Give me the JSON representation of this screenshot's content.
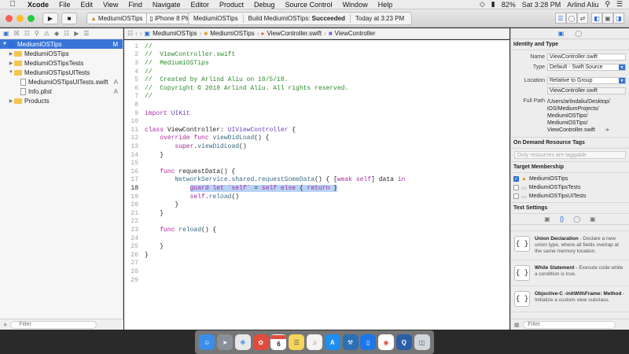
{
  "menubar": {
    "app": "Xcode",
    "items": [
      "File",
      "Edit",
      "View",
      "Find",
      "Navigate",
      "Editor",
      "Product",
      "Debug",
      "Source Control",
      "Window",
      "Help"
    ],
    "battery": "82%",
    "clock": "Sat 3:28 PM",
    "user": "Arlind Aliu"
  },
  "toolbar": {
    "scheme": "MediumiOSTips",
    "device": "iPhone 8 Plus",
    "activity_project": "MediumiOSTips",
    "activity_status_prefix": "Build MediumiOSTips: ",
    "activity_status": "Succeeded",
    "activity_time": "Today at 3:23 PM"
  },
  "navigator": {
    "items": [
      {
        "label": "MediumiOSTips",
        "status": "M",
        "selected": true
      },
      {
        "label": "MediumiOSTips",
        "status": ""
      },
      {
        "label": "MediumiOSTipsTests",
        "status": ""
      },
      {
        "label": "MediumiOSTipsUITests",
        "status": ""
      },
      {
        "label": "MediumiOSTipsUITests.swift",
        "status": "A"
      },
      {
        "label": "Info.plist",
        "status": "A"
      },
      {
        "label": "Products",
        "status": ""
      }
    ],
    "filter_placeholder": "Filter"
  },
  "jumpbar": {
    "crumbs": [
      "MediumiOSTips",
      "MediumiOSTips",
      "ViewController.swift",
      "ViewController"
    ]
  },
  "editor": {
    "current_line": 18,
    "lines": [
      "//",
      "//  ViewController.swift",
      "//  MediumiOSTips",
      "//",
      "//  Created by Arlind Aliu on 10/5/18.",
      "//  Copyright © 2018 Arlind Aliu. All rights reserved.",
      "//",
      "",
      "import UIKit",
      "",
      "class ViewController: UIViewController {",
      "    override func viewDidLoad() {",
      "        super.viewDidLoad()",
      "    }",
      "",
      "    func requestData() {",
      "        NetworkService.shared.requestSomeData() { [weak self] data in",
      "            guard let `self` = self else { return }",
      "            self.reload()",
      "        }",
      "    }",
      "",
      "    func reload() {",
      "",
      "    }",
      "}",
      "",
      "",
      ""
    ]
  },
  "inspector": {
    "identity_title": "Identity and Type",
    "name_label": "Name",
    "name_value": "ViewController.swift",
    "type_label": "Type",
    "type_value": "Default - Swift Source",
    "location_label": "Location",
    "location_value": "Relative to Group",
    "location_file": "ViewController.swift",
    "fullpath_label": "Full Path",
    "fullpath_lines": [
      "/Users/arlindaliu/Desktop/",
      "iOS/MediumProjects/",
      "MediumiOSTips/",
      "MediumiOSTips/",
      "ViewController.swift"
    ],
    "odr_title": "On Demand Resource Tags",
    "odr_placeholder": "Only resources are taggable",
    "tm_title": "Target Membership",
    "targets": [
      {
        "label": "MediumiOSTips",
        "checked": true
      },
      {
        "label": "MediumiOSTipsTests",
        "checked": false
      },
      {
        "label": "MediumiOSTipsUITests",
        "checked": false
      }
    ],
    "text_settings": "Text Settings",
    "library": [
      {
        "title": "Union Declaration",
        "desc": " - Declare a new union type, where all fields overlap at the same memory location."
      },
      {
        "title": "While Statement",
        "desc": " - Execute code while a condition is true."
      },
      {
        "title": "Objective-C -initWithFrame: Method",
        "desc": " - Initialize a custom view subclass."
      }
    ],
    "filter_placeholder": "Filter"
  },
  "dock": {
    "calendar_day": "6"
  }
}
